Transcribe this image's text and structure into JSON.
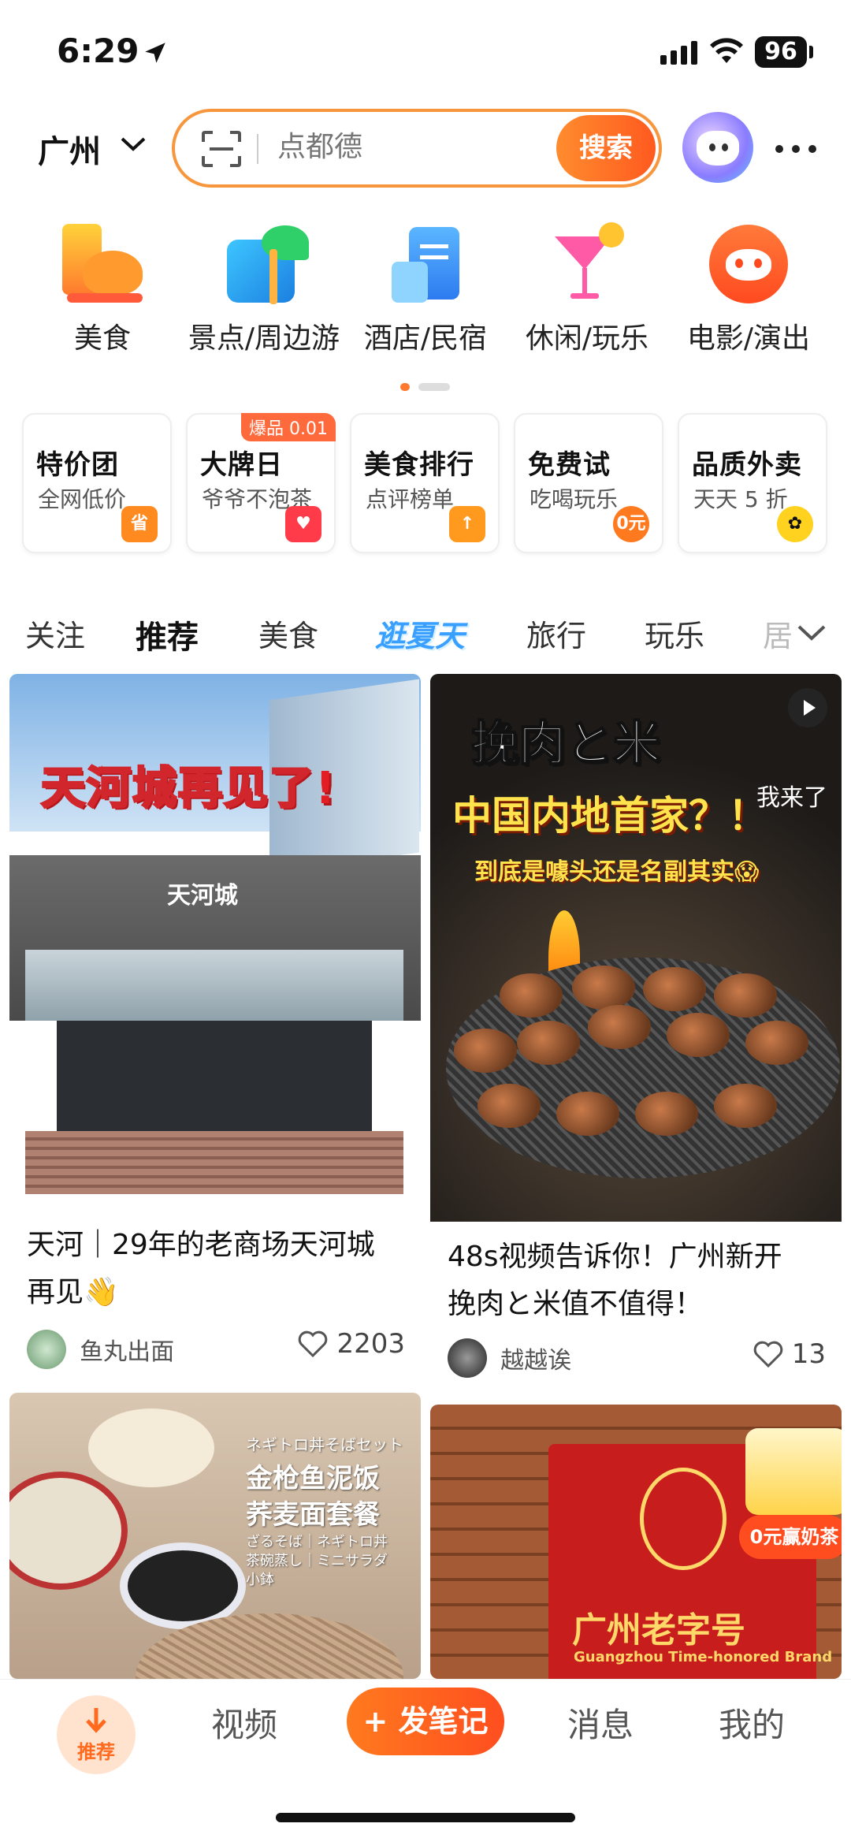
{
  "status_bar": {
    "time": "6:29",
    "battery": "96"
  },
  "header": {
    "city": "广州",
    "search_placeholder": "点都德",
    "search_button": "搜索"
  },
  "categories": [
    {
      "label": "美食",
      "icon": "food-icon"
    },
    {
      "label": "景点/周边游",
      "icon": "palm-tree-icon"
    },
    {
      "label": "酒店/民宿",
      "icon": "hotel-icon"
    },
    {
      "label": "休闲/玩乐",
      "icon": "cocktail-icon"
    },
    {
      "label": "电影/演出",
      "icon": "cat-face-icon"
    }
  ],
  "promos": [
    {
      "title": "特价团",
      "subtitle": "全网低价",
      "badge": "省"
    },
    {
      "title": "大牌日",
      "subtitle": "爷爷不泡茶",
      "tag": "爆品 0.01"
    },
    {
      "title": "美食排行",
      "subtitle": "点评榜单"
    },
    {
      "title": "免费试",
      "subtitle": "吃喝玩乐",
      "badge": "0元"
    },
    {
      "title": "品质外卖",
      "subtitle": "天天 5 折"
    }
  ],
  "tabs": [
    "关注",
    "推荐",
    "美食",
    "逛夏天",
    "旅行",
    "玩乐",
    "居"
  ],
  "feed": [
    {
      "image_text": {
        "banner": "天河城再见了",
        "mark": "!",
        "sign": "天河城"
      },
      "title_line1": "天河｜29年的老商场天河城",
      "title_line2": "再见👋",
      "author": "鱼丸出面",
      "likes": "2203"
    },
    {
      "image_text": {
        "headline": "挽肉と米",
        "subhead": "中国内地首家？！",
        "caption": "到底是噱头还是名副其实😱",
        "overlay": "我来了"
      },
      "title_line1": "48s视频告诉你！广州新开",
      "title_line2": "挽肉と米值不值得！",
      "author": "越越诶",
      "likes": "13"
    },
    {
      "image_text": {
        "jp": "ネギトロ丼そばセット",
        "line1": "金枪鱼泥饭",
        "line2": "荞麦面套餐",
        "sub1": "ざるそば｜ネギトロ丼",
        "sub2": "茶碗蒸し｜ミニサラダ",
        "sub3": "小鉢"
      }
    },
    {
      "image_text": {
        "sign_cn": "广州老字号",
        "sign_en": "Guangzhou Time-honored Brand",
        "promo": "0元赢奶茶"
      }
    }
  ],
  "bottom_nav": {
    "home": "推荐",
    "video": "视频",
    "post": "+ 发笔记",
    "messages": "消息",
    "me": "我的"
  },
  "colors": {
    "accent": "#ff6a1f",
    "search_border": "#f7963c"
  }
}
